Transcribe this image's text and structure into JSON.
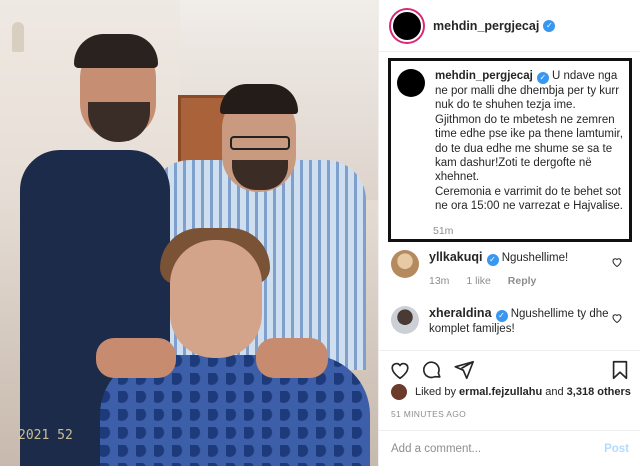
{
  "post": {
    "author": "mehdin_pergjecaj",
    "verified_icon": "verified-badge-icon",
    "photo_watermark": "2021 52"
  },
  "caption": {
    "author": "mehdin_pergjecaj",
    "lines": [
      "U ndave nga ne por malli dhe dhembja per ty kurr nuk do te shuhen tezja ime.",
      "Gjithmon do te mbetesh ne zemren time edhe pse ike pa thene lamtumir, do te dua edhe me shume se sa te kam dashur!Zoti te dergofte në xhehnet.",
      "Ceremonia e varrimit do te behet sot ne ora 15:00 ne varrezat e Hajvalise."
    ],
    "time": "51m"
  },
  "comments": [
    {
      "user": "yllkakuqi",
      "text": "Ngushellime!",
      "time": "13m",
      "likes": "1 like",
      "reply": "Reply"
    },
    {
      "user": "xheraldina",
      "text": "Ngushellime ty dhe komplet familjes!",
      "time": "",
      "likes": "",
      "reply": ""
    }
  ],
  "actions": {
    "like_icon": "heart-icon",
    "comment_icon": "comment-icon",
    "share_icon": "share-icon",
    "save_icon": "bookmark-icon"
  },
  "likes": {
    "prefix": "Liked by",
    "user": "ermal.fejzullahu",
    "joiner": "and",
    "others": "3,318 others"
  },
  "timestamp": "51 MINUTES AGO",
  "add_comment": {
    "placeholder": "Add a comment...",
    "post_label": "Post"
  },
  "colors": {
    "verified": "#3897f0",
    "post_disabled": "#b3dbff",
    "secondary_text": "#8e8e8e"
  }
}
